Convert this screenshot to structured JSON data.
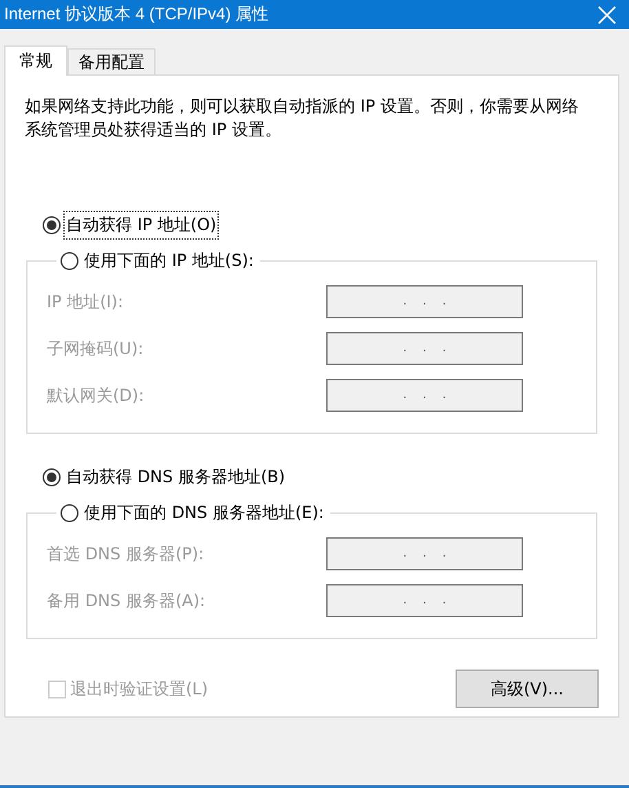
{
  "window": {
    "title": "Internet 协议版本 4 (TCP/IPv4) 属性"
  },
  "tabs": [
    {
      "label": "常规",
      "selected": true
    },
    {
      "label": "备用配置",
      "selected": false
    }
  ],
  "description": "如果网络支持此功能，则可以获取自动指派的 IP 设置。否则，你需要从网络系统管理员处获得适当的 IP 设置。",
  "sections": [
    {
      "auto": {
        "label": "自动获得 IP 地址(O)",
        "selected": true
      },
      "manual": {
        "label": "使用下面的 IP 地址(S):",
        "selected": false
      },
      "fields": [
        {
          "label": "IP 地址(I):",
          "value": ".    .    .",
          "disabled": true
        },
        {
          "label": "子网掩码(U):",
          "value": ".    .    .",
          "disabled": true
        },
        {
          "label": "默认网关(D):",
          "value": ".    .    .",
          "disabled": true
        }
      ]
    },
    {
      "auto": {
        "label": "自动获得 DNS 服务器地址(B)",
        "selected": true
      },
      "manual": {
        "label": "使用下面的 DNS 服务器地址(E):",
        "selected": false
      },
      "fields": [
        {
          "label": "首选 DNS 服务器(P):",
          "value": ".    .    .",
          "disabled": true
        },
        {
          "label": "备用 DNS 服务器(A):",
          "value": ".    .    .",
          "disabled": true
        }
      ]
    }
  ],
  "validate_checkbox": {
    "label": "退出时验证设置(L)",
    "checked": false,
    "disabled": true
  },
  "advanced_button": {
    "label": "高级(V)..."
  }
}
